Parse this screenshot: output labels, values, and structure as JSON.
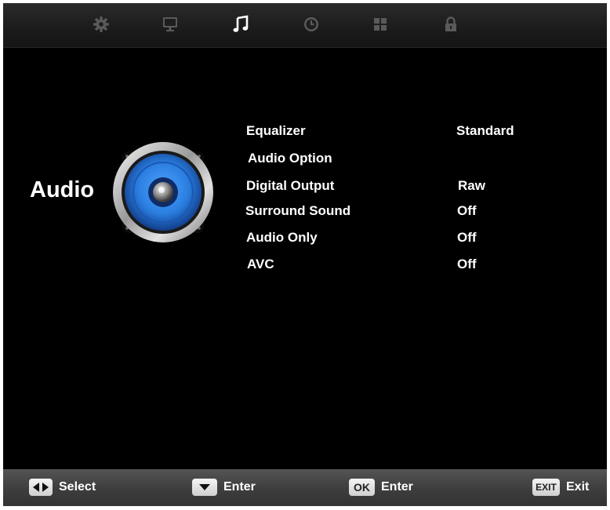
{
  "tabs": [
    {
      "name": "picture-settings",
      "icon": "gear-icon"
    },
    {
      "name": "display",
      "icon": "monitor-icon"
    },
    {
      "name": "audio",
      "icon": "music-note-icon",
      "active": true
    },
    {
      "name": "time",
      "icon": "clock-icon"
    },
    {
      "name": "apps",
      "icon": "grid-icon"
    },
    {
      "name": "lock",
      "icon": "lock-icon"
    }
  ],
  "page": {
    "title": "Audio",
    "icon": "speaker-icon"
  },
  "settings": [
    {
      "label": "Equalizer",
      "value": "Standard"
    },
    {
      "label": "Audio Option",
      "value": ""
    },
    {
      "label": "Digital Output",
      "value": "Raw"
    },
    {
      "label": "Surround Sound",
      "value": "Off"
    },
    {
      "label": "Audio Only",
      "value": "Off"
    },
    {
      "label": "AVC",
      "value": "Off"
    }
  ],
  "footer": {
    "select_label": "Select",
    "enter_label": "Enter",
    "ok_key": "OK",
    "ok_label": "Enter",
    "exit_key": "EXIT",
    "exit_label": "Exit"
  },
  "colors": {
    "background": "#000000",
    "text": "#ffffff",
    "tab_inactive": "#5a5a5a",
    "tab_active": "#ffffff",
    "speaker_blue": "#2a7ee0"
  }
}
